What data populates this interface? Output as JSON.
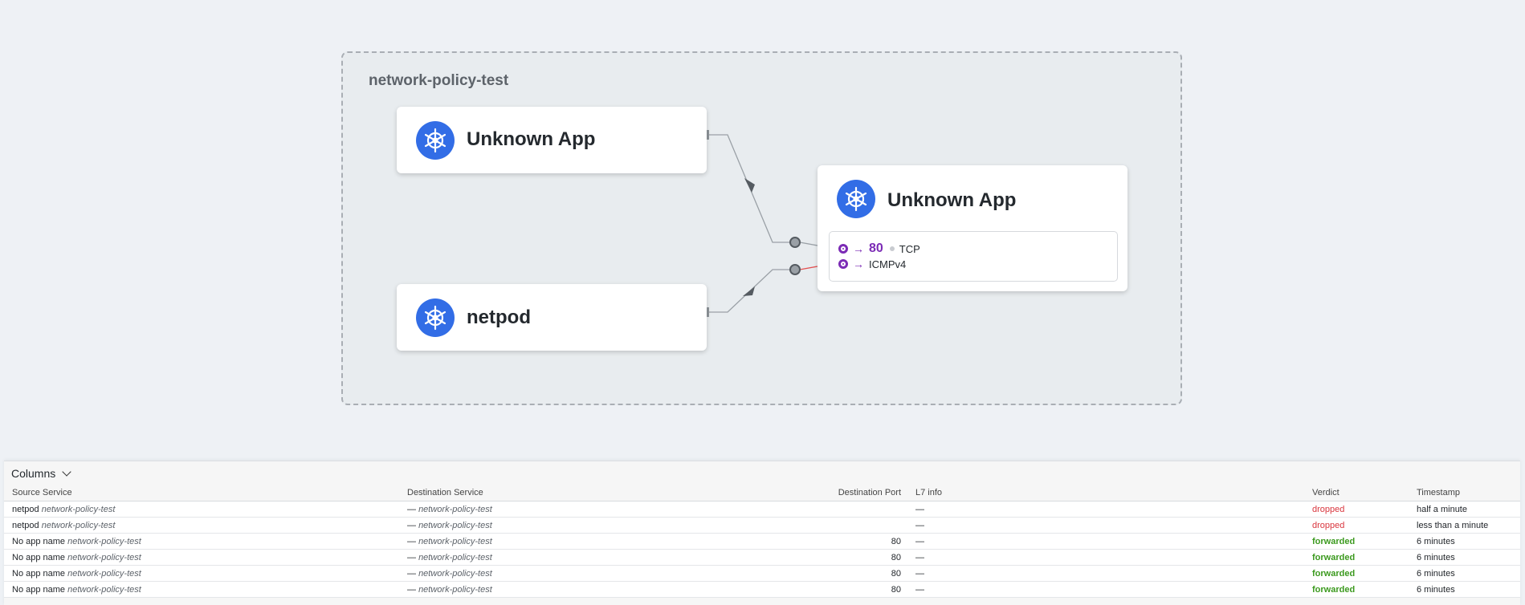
{
  "namespace": {
    "title": "network-policy-test"
  },
  "nodes": {
    "source_unknown": {
      "title": "Unknown App",
      "icon": "kubernetes-icon"
    },
    "source_netpod": {
      "title": "netpod",
      "icon": "kubernetes-icon"
    },
    "destination": {
      "title": "Unknown App",
      "icon": "kubernetes-icon",
      "ports": [
        {
          "arrow": "→",
          "port": "80",
          "protocol": "TCP"
        },
        {
          "arrow": "→",
          "port": "",
          "protocol": "ICMPv4"
        }
      ]
    }
  },
  "colors": {
    "k8s_blue": "#326de6",
    "port_purple": "#7b2bb5",
    "dropped": "#d9363e",
    "forwarded": "#3c9a1f",
    "edge_dropped": "#e35151"
  },
  "flows_panel": {
    "columns_label": "Columns",
    "headers": {
      "source": "Source Service",
      "destination": "Destination Service",
      "port": "Destination Port",
      "l7": "L7 info",
      "verdict": "Verdict",
      "timestamp": "Timestamp"
    },
    "rows": [
      {
        "src_name": "netpod",
        "src_ns": "network-policy-test",
        "dst_name": "—",
        "dst_ns": "network-policy-test",
        "port": "",
        "l7": "—",
        "verdict": "dropped",
        "time": "half a minute"
      },
      {
        "src_name": "netpod",
        "src_ns": "network-policy-test",
        "dst_name": "—",
        "dst_ns": "network-policy-test",
        "port": "",
        "l7": "—",
        "verdict": "dropped",
        "time": "less than a minute"
      },
      {
        "src_name": "No app name",
        "src_ns": "network-policy-test",
        "dst_name": "—",
        "dst_ns": "network-policy-test",
        "port": "80",
        "l7": "—",
        "verdict": "forwarded",
        "time": "6 minutes"
      },
      {
        "src_name": "No app name",
        "src_ns": "network-policy-test",
        "dst_name": "—",
        "dst_ns": "network-policy-test",
        "port": "80",
        "l7": "—",
        "verdict": "forwarded",
        "time": "6 minutes"
      },
      {
        "src_name": "No app name",
        "src_ns": "network-policy-test",
        "dst_name": "—",
        "dst_ns": "network-policy-test",
        "port": "80",
        "l7": "—",
        "verdict": "forwarded",
        "time": "6 minutes"
      },
      {
        "src_name": "No app name",
        "src_ns": "network-policy-test",
        "dst_name": "—",
        "dst_ns": "network-policy-test",
        "port": "80",
        "l7": "—",
        "verdict": "forwarded",
        "time": "6 minutes"
      }
    ]
  }
}
